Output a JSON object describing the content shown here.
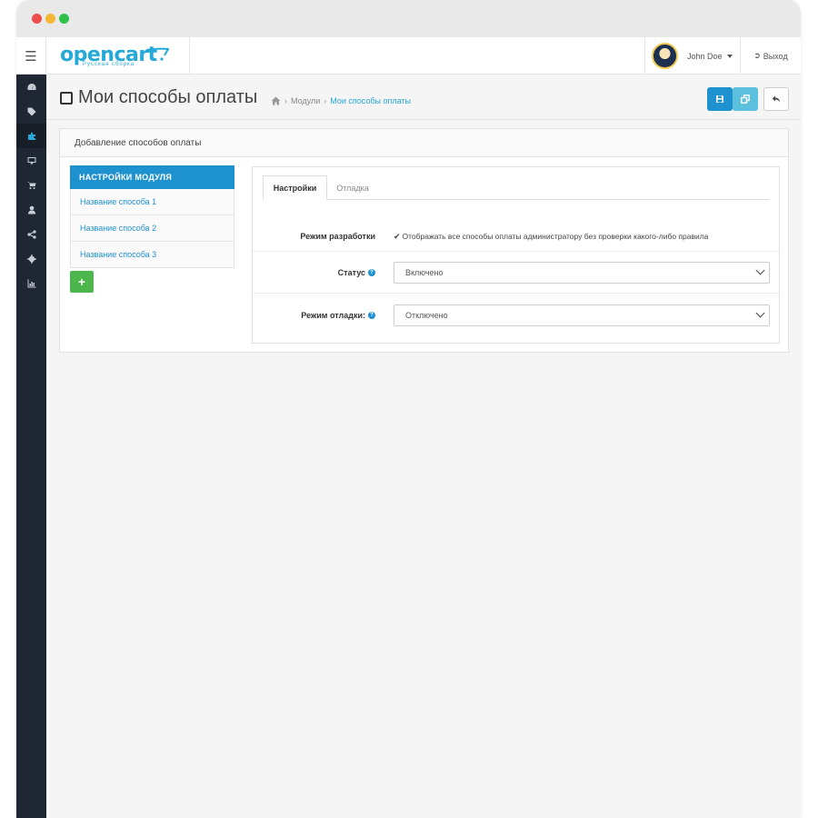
{
  "app": {
    "logo_text": "opencart",
    "logo_subtitle": "Русская сборка"
  },
  "header": {
    "user_name": "John Doe",
    "logout_label": "Выход"
  },
  "sidebar": {
    "items": [
      {
        "icon": "dashboard-icon"
      },
      {
        "icon": "tags-icon"
      },
      {
        "icon": "puzzle-icon",
        "active": true
      },
      {
        "icon": "desktop-icon"
      },
      {
        "icon": "cart-icon"
      },
      {
        "icon": "user-icon"
      },
      {
        "icon": "share-icon"
      },
      {
        "icon": "cog-icon"
      },
      {
        "icon": "bar-chart-icon"
      }
    ]
  },
  "page": {
    "title": "Мои способы оплаты",
    "breadcrumb": [
      {
        "label": "Модули"
      },
      {
        "label": "Мои способы оплаты"
      }
    ]
  },
  "panel": {
    "heading": "Добавление способов оплаты"
  },
  "module_nav": {
    "heading": "НАСТРОЙКИ МОДУЛЯ",
    "items": [
      {
        "label": "Название способа 1"
      },
      {
        "label": "Название способа 2"
      },
      {
        "label": "Название способа 3"
      }
    ],
    "add_label": "+"
  },
  "tabs": [
    {
      "label": "Настройки",
      "active": true
    },
    {
      "label": "Отладка",
      "active": false
    }
  ],
  "form": {
    "dev_mode": {
      "label": "Режим разработки",
      "checkbox_text": "Отображать все способы оплаты администратору без проверки какого-либо правила",
      "checked": true
    },
    "status": {
      "label": "Статус",
      "value": "Включено"
    },
    "debug_mode": {
      "label": "Режим отладки:",
      "value": "Отключено"
    }
  },
  "colors": {
    "primary": "#1e91cf",
    "info": "#5bc0de",
    "success": "#4cb64c",
    "sidebar": "#1e2733"
  }
}
